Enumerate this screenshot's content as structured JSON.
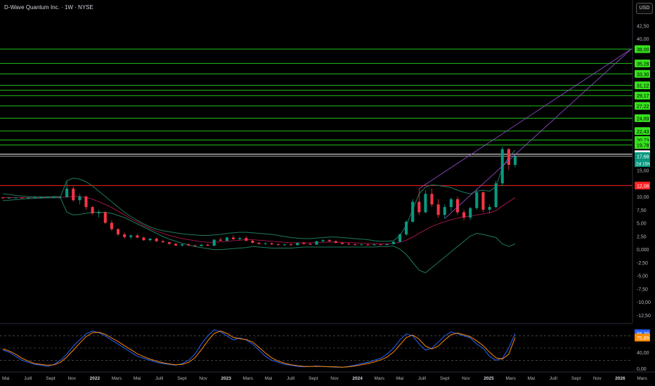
{
  "header": {
    "title": "D-Wave Quantum Inc. · 1W · NYSE",
    "currency_button": "USD"
  },
  "colors": {
    "background": "#000000",
    "up": "#089981",
    "down": "#f23645",
    "resistance": "#22c31c",
    "label_green": "#36e21d",
    "support": "#ff2020",
    "last_price_line": "#ffffff",
    "bollinger": "#1d7a5c",
    "bollinger_mid": "#c2185b",
    "wedge": "#9c4fd6",
    "stoch_k": "#2962ff",
    "stoch_d": "#ff8c00",
    "axis_text": "#b2b5be"
  },
  "chart_data": [
    {
      "type": "candlestick",
      "title": "D-Wave Quantum Inc. · 1W · NYSE",
      "currency": "USD",
      "ylim": [
        -14,
        42
      ],
      "price_ticks": [
        "42,50",
        "40,00",
        "38,00",
        "35,28",
        "33,30",
        "31,12",
        "29,17",
        "27,22",
        "24,89",
        "22,43",
        "20,73",
        "19,78",
        "18,04",
        "17,68",
        "15,00",
        "12,08",
        "10,00",
        "7,50",
        "5,00",
        "2,50",
        "0,000",
        "-2,50",
        "-5,00",
        "-7,50",
        "-10,00",
        "-12,50"
      ],
      "levels": {
        "resistance": [
          38.0,
          35.28,
          33.3,
          31.12,
          30.2,
          29.17,
          27.22,
          24.89,
          22.43,
          20.73,
          19.78
        ],
        "resistance_labels": [
          "38,00",
          "35,28",
          "33,30",
          "31,12",
          "",
          "29,17",
          "27,22",
          "24,89",
          "22,43",
          "20,73",
          "19,78"
        ],
        "white_level": 18.04,
        "white_label": "18,04",
        "last_price": 17.68,
        "last_price_label": "17,68",
        "countdown": "2d 15h",
        "support": 12.08,
        "support_label": "12,08"
      },
      "time_labels": [
        "Mai",
        "Juill",
        "Sept",
        "Nov",
        "2022",
        "Mars",
        "Mai",
        "Juill",
        "Sept",
        "Nov",
        "2023",
        "Mars",
        "Mai",
        "Juill",
        "Sept",
        "Nov",
        "2024",
        "Mars",
        "Mai",
        "Juill",
        "Sept",
        "Nov",
        "2025",
        "Mars",
        "Mai",
        "Juill",
        "Sept",
        "Nov",
        "2026",
        "Mars",
        "Mai"
      ],
      "ohlc": [
        [
          9.8,
          9.9,
          9.6,
          9.7
        ],
        [
          9.7,
          9.8,
          9.6,
          9.75
        ],
        [
          9.8,
          9.9,
          9.7,
          9.8
        ],
        [
          9.8,
          9.85,
          9.7,
          9.75
        ],
        [
          9.75,
          9.85,
          9.7,
          9.8
        ],
        [
          9.8,
          9.9,
          9.75,
          9.85
        ],
        [
          9.85,
          9.9,
          9.8,
          9.85
        ],
        [
          9.85,
          9.9,
          9.8,
          9.9
        ],
        [
          9.9,
          9.95,
          9.85,
          9.9
        ],
        [
          9.9,
          9.95,
          9.85,
          9.9
        ],
        [
          9.9,
          13,
          9.7,
          11.5
        ],
        [
          11.5,
          11.9,
          9,
          9.3
        ],
        [
          9.3,
          10.5,
          8.5,
          10
        ],
        [
          10,
          10.2,
          7.5,
          8
        ],
        [
          8,
          8.2,
          6.5,
          6.8
        ],
        [
          6.8,
          7.5,
          6,
          7
        ],
        [
          7,
          7.2,
          4.8,
          5
        ],
        [
          5,
          5.5,
          3.5,
          3.8
        ],
        [
          3.8,
          4,
          2.5,
          2.8
        ],
        [
          2.8,
          3.2,
          2,
          2.3
        ],
        [
          2.3,
          2.8,
          1.9,
          2.6
        ],
        [
          2.6,
          2.9,
          2.1,
          2.2
        ],
        [
          2.2,
          2.4,
          1.6,
          1.7
        ],
        [
          1.7,
          2.1,
          1.5,
          2
        ],
        [
          2,
          2.2,
          1.4,
          1.5
        ],
        [
          1.5,
          1.8,
          1.2,
          1.3
        ],
        [
          1.3,
          1.5,
          0.9,
          1
        ],
        [
          1,
          1.2,
          0.6,
          0.7
        ],
        [
          0.7,
          1,
          0.5,
          0.9
        ],
        [
          0.9,
          1.1,
          0.6,
          0.7
        ],
        [
          0.7,
          0.9,
          0.5,
          0.6
        ],
        [
          0.6,
          0.9,
          0.5,
          0.85
        ],
        [
          0.85,
          1,
          0.6,
          0.65
        ],
        [
          0.65,
          1.9,
          0.6,
          1.8
        ],
        [
          1.8,
          2.2,
          1.5,
          1.6
        ],
        [
          1.6,
          2.4,
          1.4,
          2.2
        ],
        [
          2.2,
          2.6,
          1.8,
          1.9
        ],
        [
          1.9,
          2.3,
          1.6,
          2.1
        ],
        [
          2.1,
          2.5,
          1.5,
          1.6
        ],
        [
          1.6,
          1.8,
          1.1,
          1.2
        ],
        [
          1.2,
          1.4,
          0.9,
          1
        ],
        [
          1,
          1.3,
          0.8,
          1.1
        ],
        [
          1.1,
          1.3,
          0.8,
          0.9
        ],
        [
          0.9,
          1.1,
          0.7,
          0.8
        ],
        [
          0.8,
          1,
          0.6,
          0.9
        ],
        [
          0.9,
          1.1,
          0.7,
          0.75
        ],
        [
          0.75,
          1.3,
          0.7,
          1.2
        ],
        [
          1.2,
          1.4,
          0.9,
          1
        ],
        [
          1,
          1.2,
          0.8,
          0.85
        ],
        [
          0.85,
          1.6,
          0.8,
          1.5
        ],
        [
          1.5,
          1.9,
          1.3,
          1.7
        ],
        [
          1.7,
          1.9,
          1.4,
          1.5
        ],
        [
          1.5,
          1.7,
          1.1,
          1.2
        ],
        [
          1.2,
          1.4,
          0.9,
          1
        ],
        [
          1,
          1.2,
          0.8,
          0.9
        ],
        [
          0.9,
          1.1,
          0.7,
          0.8
        ],
        [
          0.8,
          1,
          0.7,
          0.9
        ],
        [
          0.9,
          1,
          0.7,
          0.75
        ],
        [
          0.75,
          0.95,
          0.7,
          0.9
        ],
        [
          0.9,
          1,
          0.75,
          0.8
        ],
        [
          0.8,
          1,
          0.7,
          0.95
        ],
        [
          0.95,
          1.5,
          0.9,
          1.4
        ],
        [
          1.4,
          3,
          1.3,
          2.8
        ],
        [
          2.8,
          5.5,
          2.5,
          5.2
        ],
        [
          5.2,
          9.5,
          5,
          9
        ],
        [
          9,
          11.5,
          6.5,
          7
        ],
        [
          7,
          11.2,
          6.8,
          10.5
        ],
        [
          10.5,
          11.5,
          8,
          8.5
        ],
        [
          8.5,
          9.5,
          6,
          6.5
        ],
        [
          6.5,
          8.5,
          5.8,
          8
        ],
        [
          8,
          9.8,
          7.2,
          9.5
        ],
        [
          9.5,
          10,
          6.5,
          7
        ],
        [
          7,
          7.5,
          5.5,
          6
        ],
        [
          6,
          8,
          5.5,
          7.8
        ],
        [
          7.8,
          11.5,
          7.5,
          10.8
        ],
        [
          10.8,
          11,
          7,
          7.5
        ],
        [
          7.5,
          8.5,
          6.8,
          8
        ],
        [
          8,
          13,
          7.8,
          12.5
        ],
        [
          12.5,
          19.5,
          12,
          19
        ],
        [
          19,
          19.2,
          15,
          16
        ],
        [
          16,
          18,
          15.5,
          17.68
        ]
      ],
      "bollinger": {
        "upper": [
          10.5,
          10.4,
          10.2,
          10.1,
          10,
          10,
          9.95,
          9.95,
          10,
          10,
          13,
          13.5,
          13.3,
          12.8,
          12,
          11,
          10,
          9,
          8,
          7,
          6.2,
          5.5,
          4.8,
          4.2,
          3.8,
          3.5,
          3.3,
          3.1,
          2.9,
          2.8,
          2.7,
          2.6,
          2.6,
          2.7,
          2.8,
          3,
          3.1,
          3.2,
          3.2,
          3.1,
          3,
          2.9,
          2.8,
          2.6,
          2.4,
          2.2,
          2.1,
          2,
          2,
          2.1,
          2.2,
          2.3,
          2.3,
          2.2,
          2.1,
          2,
          1.9,
          1.8,
          1.6,
          1.5,
          1.5,
          1.6,
          2.6,
          4.5,
          7.5,
          10.5,
          11.8,
          12.2,
          12.1,
          11.9,
          11.7,
          11.2,
          10.8,
          10.5,
          11,
          11.2,
          11,
          11.8,
          15.5,
          17.5,
          18.8
        ],
        "mid": [
          9.8,
          9.8,
          9.8,
          9.8,
          9.8,
          9.8,
          9.85,
          9.85,
          9.85,
          9.85,
          9.9,
          10,
          10,
          9.8,
          9.5,
          9,
          8.5,
          7.9,
          7.2,
          6.5,
          5.8,
          5.2,
          4.5,
          3.9,
          3.4,
          3,
          2.6,
          2.3,
          2,
          1.8,
          1.6,
          1.4,
          1.3,
          1.3,
          1.4,
          1.5,
          1.6,
          1.7,
          1.8,
          1.8,
          1.7,
          1.6,
          1.5,
          1.4,
          1.3,
          1.2,
          1.2,
          1.2,
          1.2,
          1.25,
          1.3,
          1.35,
          1.35,
          1.3,
          1.25,
          1.2,
          1.15,
          1.1,
          1,
          1,
          1,
          1.1,
          1.3,
          1.7,
          2.3,
          3,
          3.7,
          4.3,
          4.8,
          5.2,
          5.6,
          5.9,
          6.1,
          6.3,
          6.5,
          6.7,
          6.9,
          7.3,
          8.2,
          9,
          9.8
        ],
        "lower": [
          9.2,
          9.3,
          9.4,
          9.5,
          9.6,
          9.65,
          9.7,
          9.75,
          9.75,
          9.75,
          7,
          6.5,
          6.6,
          6.8,
          7,
          7,
          7,
          6.8,
          6.4,
          6,
          5.4,
          4.8,
          4.2,
          3.6,
          3,
          2.4,
          1.9,
          1.5,
          1.1,
          0.8,
          0.5,
          0.3,
          0.1,
          -0.1,
          -0.1,
          0,
          0.1,
          0.2,
          0.3,
          0.5,
          0.4,
          0.3,
          0.2,
          0.2,
          0.2,
          0.2,
          0.3,
          0.4,
          0.4,
          0.4,
          0.4,
          0.4,
          0.4,
          0.4,
          0.4,
          0.4,
          0.4,
          0.4,
          0.4,
          0.5,
          0.5,
          0.6,
          0,
          -1,
          -2.5,
          -4,
          -4.5,
          -3.5,
          -2.5,
          -1.5,
          -0.5,
          0.5,
          1.5,
          2.5,
          3,
          2.8,
          2.5,
          2.2,
          1,
          0.5,
          1
        ]
      },
      "wedge": {
        "start_index": 65,
        "end_label": "38,00"
      }
    },
    {
      "type": "line",
      "title": "",
      "ylim": [
        0,
        100
      ],
      "ticks": [
        "86,39",
        "75,89",
        "40,00",
        "0,00"
      ],
      "current": {
        "k": 86.39,
        "k_label": "86,39",
        "d": 75.89,
        "d_label": "75,89"
      },
      "bands": [
        80,
        50,
        20
      ],
      "series": [
        {
          "key": "k",
          "values": [
            45,
            40,
            30,
            20,
            15,
            10,
            8,
            5,
            10,
            20,
            35,
            55,
            70,
            85,
            92,
            88,
            80,
            70,
            60,
            50,
            40,
            30,
            25,
            20,
            15,
            12,
            10,
            8,
            12,
            20,
            35,
            60,
            80,
            95,
            90,
            80,
            70,
            75,
            70,
            60,
            45,
            30,
            20,
            15,
            10,
            8,
            5,
            4,
            5,
            6,
            5,
            4,
            3,
            3,
            5,
            8,
            12,
            15,
            20,
            25,
            35,
            50,
            70,
            85,
            80,
            60,
            45,
            50,
            65,
            80,
            90,
            85,
            80,
            75,
            60,
            50,
            30,
            20,
            25,
            50,
            86
          ]
        },
        {
          "key": "d",
          "values": [
            48,
            43,
            35,
            25,
            18,
            12,
            10,
            8,
            9,
            15,
            28,
            45,
            62,
            78,
            88,
            89,
            84,
            75,
            66,
            56,
            46,
            36,
            29,
            23,
            18,
            14,
            11,
            9,
            10,
            15,
            26,
            46,
            68,
            86,
            92,
            86,
            76,
            73,
            71,
            65,
            52,
            38,
            26,
            18,
            13,
            9,
            7,
            5,
            5,
            5,
            5,
            4,
            4,
            3,
            4,
            6,
            9,
            12,
            16,
            21,
            28,
            40,
            58,
            76,
            82,
            72,
            55,
            48,
            55,
            70,
            83,
            87,
            83,
            78,
            68,
            56,
            40,
            26,
            23,
            35,
            76
          ]
        }
      ]
    }
  ]
}
